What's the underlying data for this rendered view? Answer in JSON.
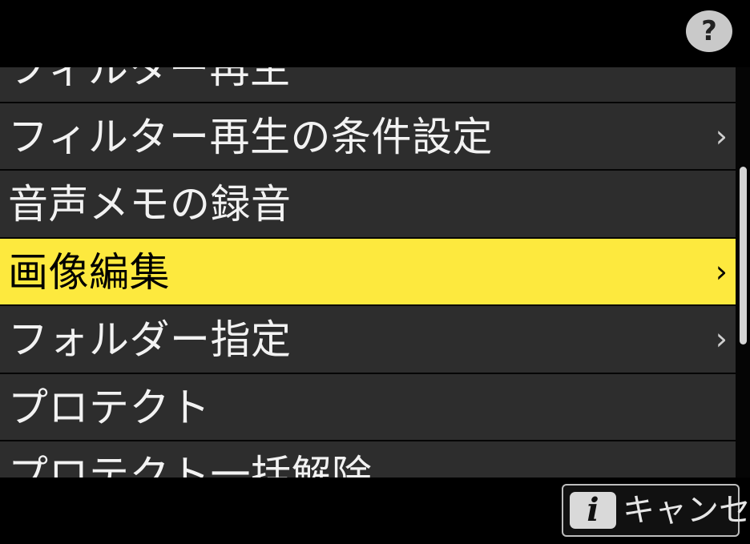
{
  "header": {
    "help_label": "?"
  },
  "menu": {
    "items": [
      {
        "label": "フィルター再生",
        "has_submenu": false,
        "selected": false
      },
      {
        "label": "フィルター再生の条件設定",
        "has_submenu": true,
        "selected": false
      },
      {
        "label": "音声メモの録音",
        "has_submenu": false,
        "selected": false
      },
      {
        "label": "画像編集",
        "has_submenu": true,
        "selected": true
      },
      {
        "label": "フォルダー指定",
        "has_submenu": true,
        "selected": false
      },
      {
        "label": "プロテクト",
        "has_submenu": false,
        "selected": false
      },
      {
        "label": "プロテクト一括解除",
        "has_submenu": false,
        "selected": false
      }
    ],
    "chevron": "›"
  },
  "footer": {
    "info_badge": "i",
    "cancel_label": "キャンセル"
  },
  "colors": {
    "selected_bg": "#fde93e",
    "row_bg": "#2d2d2d",
    "background": "#000000"
  }
}
